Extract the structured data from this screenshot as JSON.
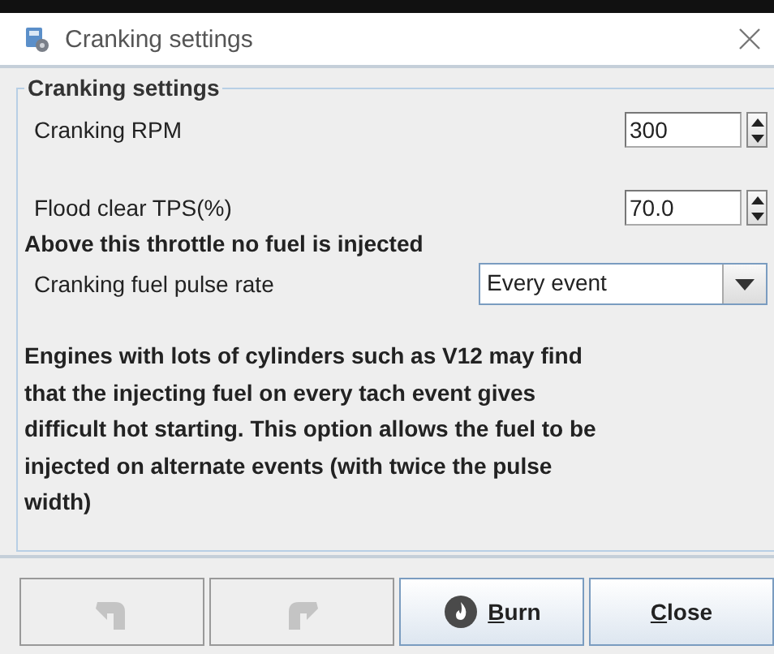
{
  "window": {
    "title": "Cranking settings"
  },
  "group": {
    "title": "Cranking settings",
    "fields": [
      {
        "kind": "spinner",
        "label": "Cranking RPM",
        "value": "300"
      },
      {
        "kind": "spinner",
        "label": "Flood clear TPS(%)",
        "value": "70.0"
      },
      {
        "kind": "note",
        "label": "Above this throttle no fuel is injected"
      },
      {
        "kind": "combo",
        "label": "Cranking fuel pulse rate",
        "value": "Every event"
      }
    ],
    "description": "Engines with lots of cylinders such as V12 may find that the injecting fuel on every tach event gives difficult hot starting. This option allows the fuel to be injected on alternate events (with twice the pulse width)"
  },
  "buttons": [
    {
      "kind": "undo",
      "disabled": true
    },
    {
      "kind": "redo",
      "disabled": true
    },
    {
      "kind": "burn",
      "label": "Burn",
      "disabled": false
    },
    {
      "kind": "close",
      "label": "Close",
      "disabled": false
    }
  ]
}
